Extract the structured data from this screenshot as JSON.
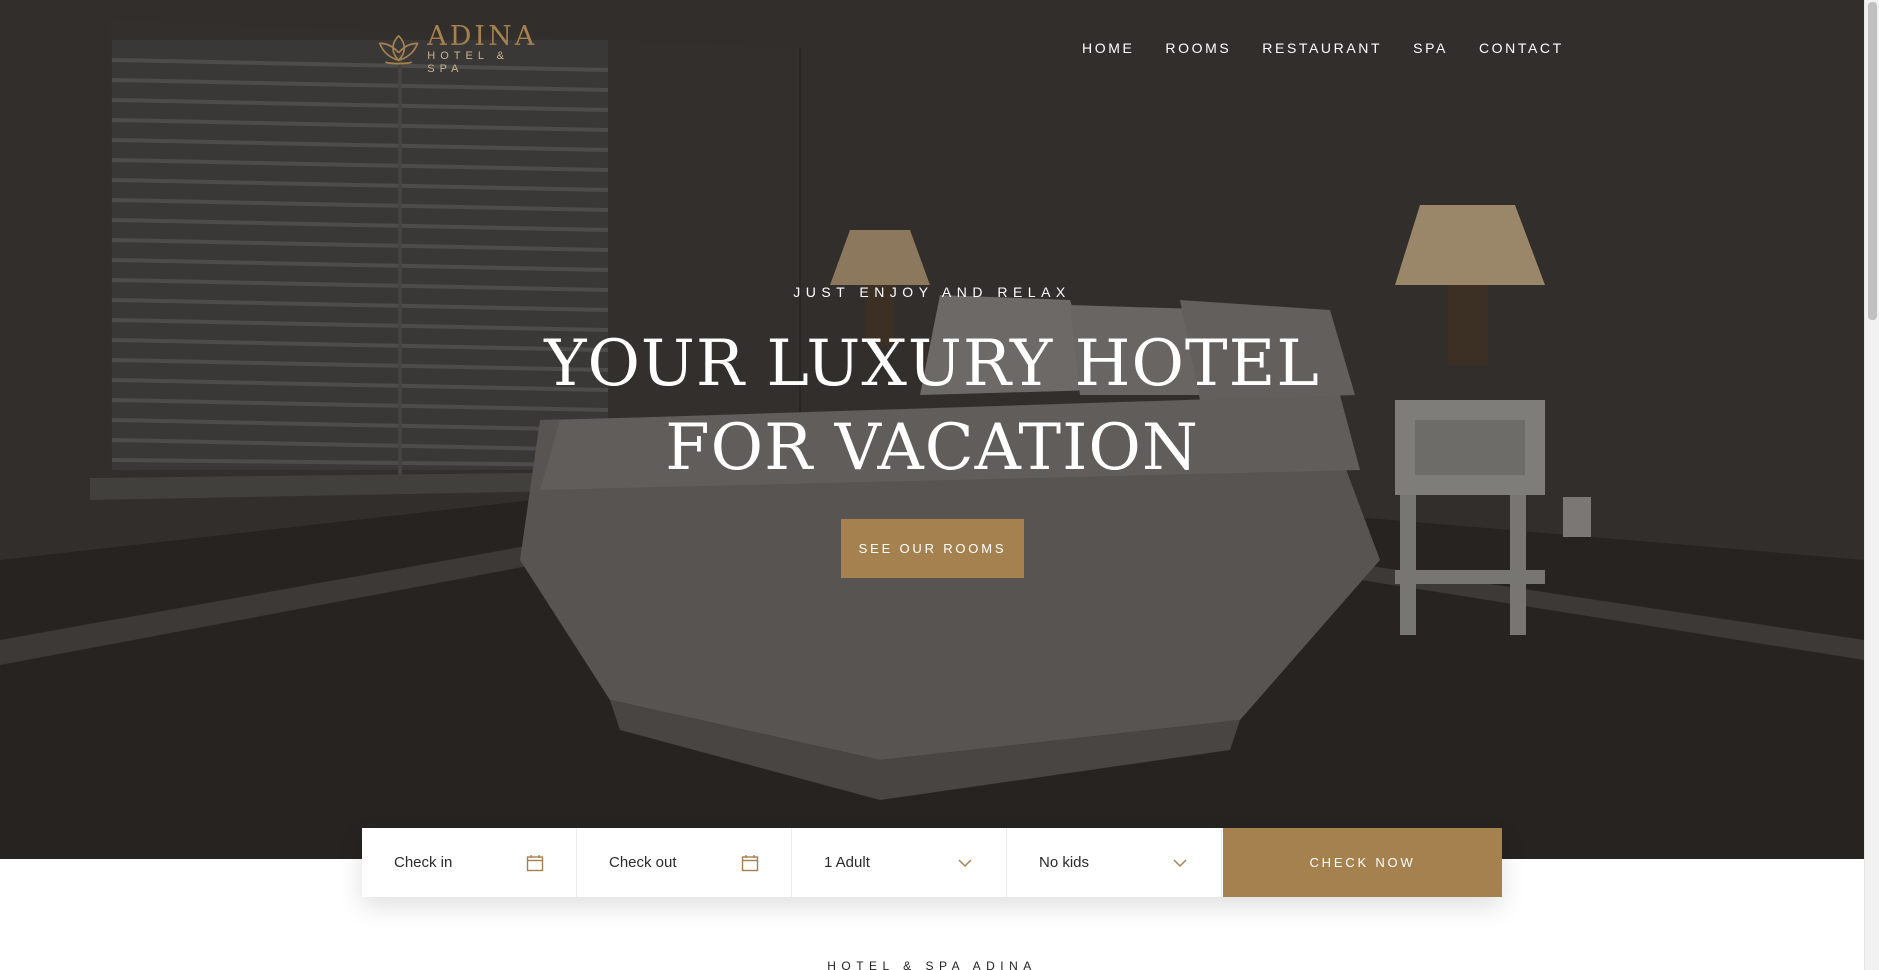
{
  "logo": {
    "name": "ADINA",
    "subtitle": "HOTEL & SPA",
    "icon": "lotus-icon",
    "color": "#a68150"
  },
  "nav": {
    "items": [
      {
        "label": "HOME"
      },
      {
        "label": "ROOMS"
      },
      {
        "label": "RESTAURANT"
      },
      {
        "label": "SPA"
      },
      {
        "label": "CONTACT"
      }
    ]
  },
  "hero": {
    "eyebrow": "JUST ENJOY AND RELAX",
    "headline_line1": "YOUR LUXURY HOTEL",
    "headline_line2": "FOR VACATION",
    "cta_label": "SEE OUR ROOMS"
  },
  "booking": {
    "checkin": {
      "label": "Check in",
      "icon": "calendar-icon"
    },
    "checkout": {
      "label": "Check out",
      "icon": "calendar-icon"
    },
    "adults": {
      "label": "1 Adult",
      "icon": "chevron-down-icon"
    },
    "kids": {
      "label": "No kids",
      "icon": "chevron-down-icon"
    },
    "submit_label": "CHECK NOW"
  },
  "next_section": {
    "eyebrow": "HOTEL & SPA ADINA"
  },
  "colors": {
    "accent": "#a68150",
    "hero_overlay": "#2e2a28",
    "text_light": "#ffffff"
  }
}
